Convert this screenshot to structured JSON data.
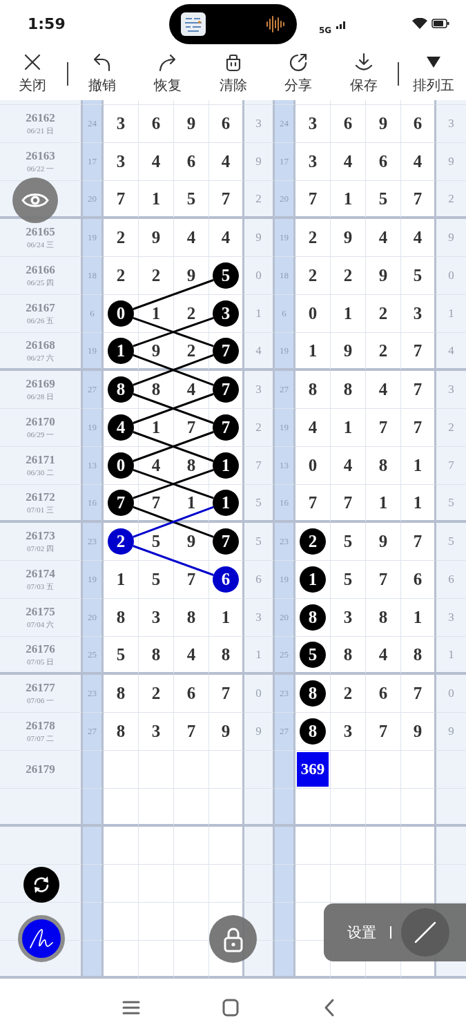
{
  "status_bar": {
    "time": "1:59",
    "network": "5G"
  },
  "toolbar": [
    {
      "kind": "close",
      "label": "关闭"
    },
    {
      "kind": "separator"
    },
    {
      "kind": "undo",
      "label": "撤销"
    },
    {
      "kind": "redo",
      "label": "恢复"
    },
    {
      "kind": "clear",
      "label": "清除"
    },
    {
      "kind": "share",
      "label": "分享"
    },
    {
      "kind": "save",
      "label": "保存"
    },
    {
      "kind": "separator"
    },
    {
      "kind": "dropdown",
      "label": "排列五"
    }
  ],
  "table": {
    "rows": [
      {
        "period": "26162",
        "date": "06/21 日",
        "left": {
          "sum": "24",
          "digits": [
            {
              "text": "3",
              "kind": "plain"
            },
            {
              "text": "6",
              "kind": "plain"
            },
            {
              "text": "9",
              "kind": "plain"
            },
            {
              "text": "6",
              "kind": "plain"
            }
          ],
          "tail": "3"
        },
        "right": {
          "sum": "24",
          "digits": [
            {
              "text": "3",
              "kind": "plain"
            },
            {
              "text": "6",
              "kind": "plain"
            },
            {
              "text": "9",
              "kind": "plain"
            },
            {
              "text": "6",
              "kind": "plain"
            }
          ],
          "tail": "3"
        }
      },
      {
        "period": "26163",
        "date": "06/22 一",
        "left": {
          "sum": "17",
          "digits": [
            {
              "text": "3",
              "kind": "plain"
            },
            {
              "text": "4",
              "kind": "plain"
            },
            {
              "text": "6",
              "kind": "plain"
            },
            {
              "text": "4",
              "kind": "plain"
            }
          ],
          "tail": "9"
        },
        "right": {
          "sum": "17",
          "digits": [
            {
              "text": "3",
              "kind": "plain"
            },
            {
              "text": "4",
              "kind": "plain"
            },
            {
              "text": "6",
              "kind": "plain"
            },
            {
              "text": "4",
              "kind": "plain"
            }
          ],
          "tail": "9"
        }
      },
      {
        "left": {
          "sum": "20",
          "digits": [
            {
              "text": "7",
              "kind": "plain"
            },
            {
              "text": "1",
              "kind": "plain"
            },
            {
              "text": "5",
              "kind": "plain"
            },
            {
              "text": "7",
              "kind": "plain"
            }
          ],
          "tail": "2"
        },
        "right": {
          "sum": "20",
          "digits": [
            {
              "text": "7",
              "kind": "plain"
            },
            {
              "text": "1",
              "kind": "plain"
            },
            {
              "text": "5",
              "kind": "plain"
            },
            {
              "text": "7",
              "kind": "plain"
            }
          ],
          "tail": "2"
        }
      },
      {
        "period": "26165",
        "date": "06/24 三",
        "left": {
          "sum": "19",
          "digits": [
            {
              "text": "2",
              "kind": "plain"
            },
            {
              "text": "9",
              "kind": "plain"
            },
            {
              "text": "4",
              "kind": "plain"
            },
            {
              "text": "4",
              "kind": "plain"
            }
          ],
          "tail": "9"
        },
        "right": {
          "sum": "19",
          "digits": [
            {
              "text": "2",
              "kind": "plain"
            },
            {
              "text": "9",
              "kind": "plain"
            },
            {
              "text": "4",
              "kind": "plain"
            },
            {
              "text": "4",
              "kind": "plain"
            }
          ],
          "tail": "9"
        }
      },
      {
        "period": "26166",
        "date": "06/25 四",
        "left": {
          "sum": "18",
          "digits": [
            {
              "text": "2",
              "kind": "plain"
            },
            {
              "text": "2",
              "kind": "plain"
            },
            {
              "text": "9",
              "kind": "plain"
            },
            {
              "text": "5",
              "kind": "circle",
              "color": "#000000",
              "line_up": false,
              "line_down": false
            }
          ],
          "tail": "0"
        },
        "right": {
          "sum": "18",
          "digits": [
            {
              "text": "2",
              "kind": "plain"
            },
            {
              "text": "2",
              "kind": "plain"
            },
            {
              "text": "9",
              "kind": "plain"
            },
            {
              "text": "5",
              "kind": "plain"
            }
          ],
          "tail": "0"
        }
      },
      {
        "period": "26167",
        "date": "06/26 五",
        "left": {
          "sum": "6",
          "digits": [
            {
              "text": "0",
              "kind": "circle",
              "color": "#000000",
              "line_up": true,
              "line_down": true
            },
            {
              "text": "1",
              "kind": "plain"
            },
            {
              "text": "2",
              "kind": "plain"
            },
            {
              "text": "3",
              "kind": "circle",
              "color": "#000000",
              "line_up": false,
              "line_down": false
            }
          ],
          "tail": "1"
        },
        "right": {
          "sum": "6",
          "digits": [
            {
              "text": "0",
              "kind": "plain"
            },
            {
              "text": "1",
              "kind": "plain"
            },
            {
              "text": "2",
              "kind": "plain"
            },
            {
              "text": "3",
              "kind": "plain"
            }
          ],
          "tail": "1"
        }
      },
      {
        "period": "26168",
        "date": "06/27 六",
        "left": {
          "sum": "19",
          "digits": [
            {
              "text": "1",
              "kind": "circle",
              "color": "#000000",
              "line_up": true,
              "line_down": true
            },
            {
              "text": "9",
              "kind": "plain"
            },
            {
              "text": "2",
              "kind": "plain"
            },
            {
              "text": "7",
              "kind": "circle",
              "color": "#000000",
              "line_up": false,
              "line_down": false
            }
          ],
          "tail": "4"
        },
        "right": {
          "sum": "19",
          "digits": [
            {
              "text": "1",
              "kind": "plain"
            },
            {
              "text": "9",
              "kind": "plain"
            },
            {
              "text": "2",
              "kind": "plain"
            },
            {
              "text": "7",
              "kind": "plain"
            }
          ],
          "tail": "4"
        }
      },
      {
        "period": "26169",
        "date": "06/28 日",
        "left": {
          "sum": "27",
          "digits": [
            {
              "text": "8",
              "kind": "circle",
              "color": "#000000",
              "line_up": true,
              "line_down": true
            },
            {
              "text": "8",
              "kind": "plain"
            },
            {
              "text": "4",
              "kind": "plain"
            },
            {
              "text": "7",
              "kind": "circle",
              "color": "#000000",
              "line_up": false,
              "line_down": false
            }
          ],
          "tail": "3"
        },
        "right": {
          "sum": "27",
          "digits": [
            {
              "text": "8",
              "kind": "plain"
            },
            {
              "text": "8",
              "kind": "plain"
            },
            {
              "text": "4",
              "kind": "plain"
            },
            {
              "text": "7",
              "kind": "plain"
            }
          ],
          "tail": "3"
        }
      },
      {
        "period": "26170",
        "date": "06/29 一",
        "left": {
          "sum": "19",
          "digits": [
            {
              "text": "4",
              "kind": "circle",
              "color": "#000000",
              "line_up": true,
              "line_down": true
            },
            {
              "text": "1",
              "kind": "plain"
            },
            {
              "text": "7",
              "kind": "plain"
            },
            {
              "text": "7",
              "kind": "circle",
              "color": "#000000",
              "line_up": false,
              "line_down": false
            }
          ],
          "tail": "2"
        },
        "right": {
          "sum": "19",
          "digits": [
            {
              "text": "4",
              "kind": "plain"
            },
            {
              "text": "1",
              "kind": "plain"
            },
            {
              "text": "7",
              "kind": "plain"
            },
            {
              "text": "7",
              "kind": "plain"
            }
          ],
          "tail": "2"
        }
      },
      {
        "period": "26171",
        "date": "06/30 二",
        "left": {
          "sum": "13",
          "digits": [
            {
              "text": "0",
              "kind": "circle",
              "color": "#000000",
              "line_up": true,
              "line_down": true
            },
            {
              "text": "4",
              "kind": "plain"
            },
            {
              "text": "8",
              "kind": "plain"
            },
            {
              "text": "1",
              "kind": "circle",
              "color": "#000000",
              "line_up": false,
              "line_down": false
            }
          ],
          "tail": "7"
        },
        "right": {
          "sum": "13",
          "digits": [
            {
              "text": "0",
              "kind": "plain"
            },
            {
              "text": "4",
              "kind": "plain"
            },
            {
              "text": "8",
              "kind": "plain"
            },
            {
              "text": "1",
              "kind": "plain"
            }
          ],
          "tail": "7"
        }
      },
      {
        "period": "26172",
        "date": "07/01 三",
        "left": {
          "sum": "16",
          "digits": [
            {
              "text": "7",
              "kind": "circle",
              "color": "#000000",
              "line_up": true,
              "line_down": true
            },
            {
              "text": "7",
              "kind": "plain"
            },
            {
              "text": "1",
              "kind": "plain"
            },
            {
              "text": "1",
              "kind": "circle",
              "color": "#000000",
              "line_up": false,
              "line_down": false
            }
          ],
          "tail": "5"
        },
        "right": {
          "sum": "16",
          "digits": [
            {
              "text": "7",
              "kind": "plain"
            },
            {
              "text": "7",
              "kind": "plain"
            },
            {
              "text": "1",
              "kind": "plain"
            },
            {
              "text": "1",
              "kind": "plain"
            }
          ],
          "tail": "5"
        }
      },
      {
        "period": "26173",
        "date": "07/02 四",
        "left": {
          "sum": "23",
          "digits": [
            {
              "text": "2",
              "kind": "circle",
              "color": "#0000cc",
              "line_up": true,
              "line_down": true
            },
            {
              "text": "5",
              "kind": "plain"
            },
            {
              "text": "9",
              "kind": "plain"
            },
            {
              "text": "7",
              "kind": "circle",
              "color": "#000000",
              "line_up": false,
              "line_down": false
            }
          ],
          "tail": "5"
        },
        "right": {
          "sum": "23",
          "digits": [
            {
              "text": "2",
              "kind": "circle",
              "color": "#000000"
            },
            {
              "text": "5",
              "kind": "plain"
            },
            {
              "text": "9",
              "kind": "plain"
            },
            {
              "text": "7",
              "kind": "plain"
            }
          ],
          "tail": "5"
        }
      },
      {
        "period": "26174",
        "date": "07/03 五",
        "left": {
          "sum": "19",
          "digits": [
            {
              "text": "1",
              "kind": "plain"
            },
            {
              "text": "5",
              "kind": "plain"
            },
            {
              "text": "7",
              "kind": "plain"
            },
            {
              "text": "6",
              "kind": "circle",
              "color": "#0000cc",
              "line_up": false,
              "line_down": false
            }
          ],
          "tail": "6"
        },
        "right": {
          "sum": "19",
          "digits": [
            {
              "text": "1",
              "kind": "circle",
              "color": "#000000"
            },
            {
              "text": "5",
              "kind": "plain"
            },
            {
              "text": "7",
              "kind": "plain"
            },
            {
              "text": "6",
              "kind": "plain"
            }
          ],
          "tail": "6"
        }
      },
      {
        "period": "26175",
        "date": "07/04 六",
        "left": {
          "sum": "20",
          "digits": [
            {
              "text": "8",
              "kind": "plain"
            },
            {
              "text": "3",
              "kind": "plain"
            },
            {
              "text": "8",
              "kind": "plain"
            },
            {
              "text": "1",
              "kind": "plain"
            }
          ],
          "tail": "3"
        },
        "right": {
          "sum": "20",
          "digits": [
            {
              "text": "8",
              "kind": "circle",
              "color": "#000000"
            },
            {
              "text": "3",
              "kind": "plain"
            },
            {
              "text": "8",
              "kind": "plain"
            },
            {
              "text": "1",
              "kind": "plain"
            }
          ],
          "tail": "3"
        }
      },
      {
        "period": "26176",
        "date": "07/05 日",
        "left": {
          "sum": "25",
          "digits": [
            {
              "text": "5",
              "kind": "plain"
            },
            {
              "text": "8",
              "kind": "plain"
            },
            {
              "text": "4",
              "kind": "plain"
            },
            {
              "text": "8",
              "kind": "plain"
            }
          ],
          "tail": "1"
        },
        "right": {
          "sum": "25",
          "digits": [
            {
              "text": "5",
              "kind": "circle",
              "color": "#000000"
            },
            {
              "text": "8",
              "kind": "plain"
            },
            {
              "text": "4",
              "kind": "plain"
            },
            {
              "text": "8",
              "kind": "plain"
            }
          ],
          "tail": "1"
        }
      },
      {
        "period": "26177",
        "date": "07/06 一",
        "left": {
          "sum": "23",
          "digits": [
            {
              "text": "8",
              "kind": "plain"
            },
            {
              "text": "2",
              "kind": "plain"
            },
            {
              "text": "6",
              "kind": "plain"
            },
            {
              "text": "7",
              "kind": "plain"
            }
          ],
          "tail": "0"
        },
        "right": {
          "sum": "23",
          "digits": [
            {
              "text": "8",
              "kind": "circle",
              "color": "#000000"
            },
            {
              "text": "2",
              "kind": "plain"
            },
            {
              "text": "6",
              "kind": "plain"
            },
            {
              "text": "7",
              "kind": "plain"
            }
          ],
          "tail": "0"
        }
      },
      {
        "period": "26178",
        "date": "07/07 二",
        "left": {
          "sum": "27",
          "digits": [
            {
              "text": "8",
              "kind": "plain"
            },
            {
              "text": "3",
              "kind": "plain"
            },
            {
              "text": "7",
              "kind": "plain"
            },
            {
              "text": "9",
              "kind": "plain"
            }
          ],
          "tail": "9"
        },
        "right": {
          "sum": "27",
          "digits": [
            {
              "text": "8",
              "kind": "circle",
              "color": "#000000"
            },
            {
              "text": "3",
              "kind": "plain"
            },
            {
              "text": "7",
              "kind": "plain"
            },
            {
              "text": "9",
              "kind": "plain"
            }
          ],
          "tail": "9"
        }
      },
      {
        "period": "26179",
        "right": {
          "digits": [
            {
              "text": "369",
              "kind": "box",
              "color": "#0000ee"
            }
          ]
        }
      }
    ]
  },
  "settings_panel": {
    "label": "设置"
  }
}
